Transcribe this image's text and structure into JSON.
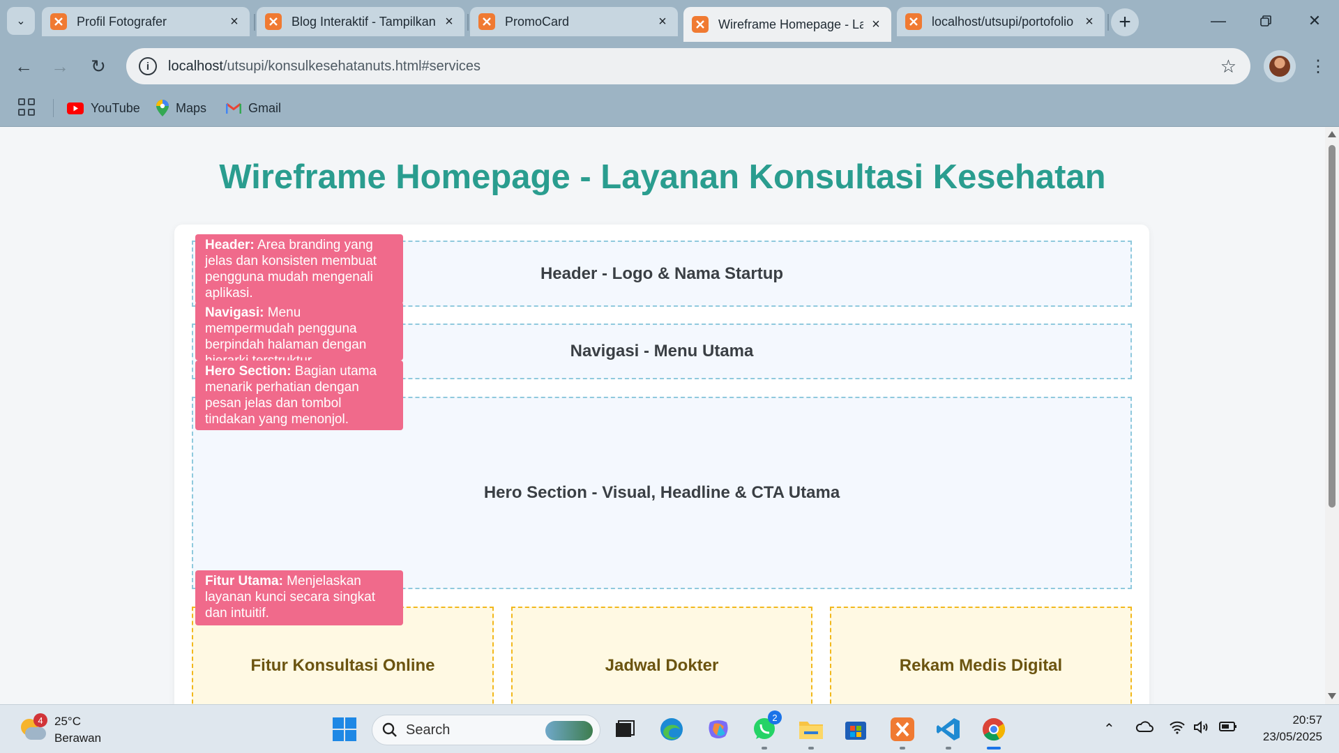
{
  "browser": {
    "tabs": [
      {
        "title": "Profil Fotografer",
        "active": false
      },
      {
        "title": "Blog Interaktif - Tampilkan",
        "active": false
      },
      {
        "title": "PromoCard",
        "active": false
      },
      {
        "title": "Wireframe Homepage - Layanan",
        "active": true
      },
      {
        "title": "localhost/utsupi/portofolio",
        "active": false
      }
    ],
    "address": {
      "host": "localhost",
      "path": "/utsupi/konsulkesehatanuts.html#services"
    },
    "bookmarks": [
      "YouTube",
      "Maps",
      "Gmail"
    ]
  },
  "page": {
    "title": "Wireframe Homepage - Layanan Konsultasi Kesehatan",
    "sections": {
      "header": "Header - Logo & Nama Startup",
      "nav": "Navigasi - Menu Utama",
      "hero": "Hero Section - Visual, Headline & CTA Utama"
    },
    "features": [
      "Fitur Konsultasi Online",
      "Jadwal Dokter",
      "Rekam Medis Digital"
    ],
    "notes": [
      {
        "label": "Header:",
        "text": " Area branding yang jelas dan konsisten membuat pengguna mudah mengenali aplikasi."
      },
      {
        "label": "Navigasi:",
        "text": " Menu mempermudah pengguna berpindah halaman dengan hierarki terstruktur."
      },
      {
        "label": "Hero Section:",
        "text": " Bagian utama menarik perhatian dengan pesan jelas dan tombol tindakan yang menonjol."
      },
      {
        "label": "Fitur Utama:",
        "text": " Menjelaskan layanan kunci secara singkat dan intuitif."
      }
    ]
  },
  "taskbar": {
    "weather": {
      "temp": "25°C",
      "condition": "Berawan",
      "badge": "4"
    },
    "search_label": "Search",
    "whatsapp_badge": "2",
    "clock": {
      "time": "20:57",
      "date": "23/05/2025"
    }
  },
  "colors": {
    "title_teal": "#2a9d8f",
    "note_pink": "#f06a8b",
    "feature_border": "#f2b81c",
    "section_border": "#8fc9dd"
  }
}
